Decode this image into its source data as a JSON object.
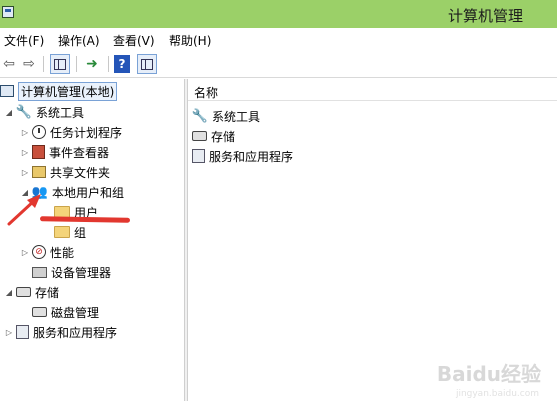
{
  "window": {
    "title": "计算机管理"
  },
  "menu": [
    "文件(F)",
    "操作(A)",
    "查看(V)",
    "帮助(H)"
  ],
  "toolbar": {
    "back_icon": "back-arrow-icon",
    "forward_icon": "forward-arrow-icon",
    "help_label": "?"
  },
  "tree": {
    "root": "计算机管理(本地)",
    "system_tools": "系统工具",
    "task_scheduler": "任务计划程序",
    "event_viewer": "事件查看器",
    "shared_folders": "共享文件夹",
    "local_users": "本地用户和组",
    "users": "用户",
    "groups": "组",
    "performance": "性能",
    "device_manager": "设备管理器",
    "storage": "存储",
    "disk_management": "磁盘管理",
    "services_apps": "服务和应用程序"
  },
  "list": {
    "column_name": "名称",
    "items": [
      "系统工具",
      "存储",
      "服务和应用程序"
    ]
  },
  "annotation": {
    "color": "#e2372f"
  },
  "watermark": {
    "text": "Baidu经验",
    "sub": "jingyan.baidu.com"
  }
}
